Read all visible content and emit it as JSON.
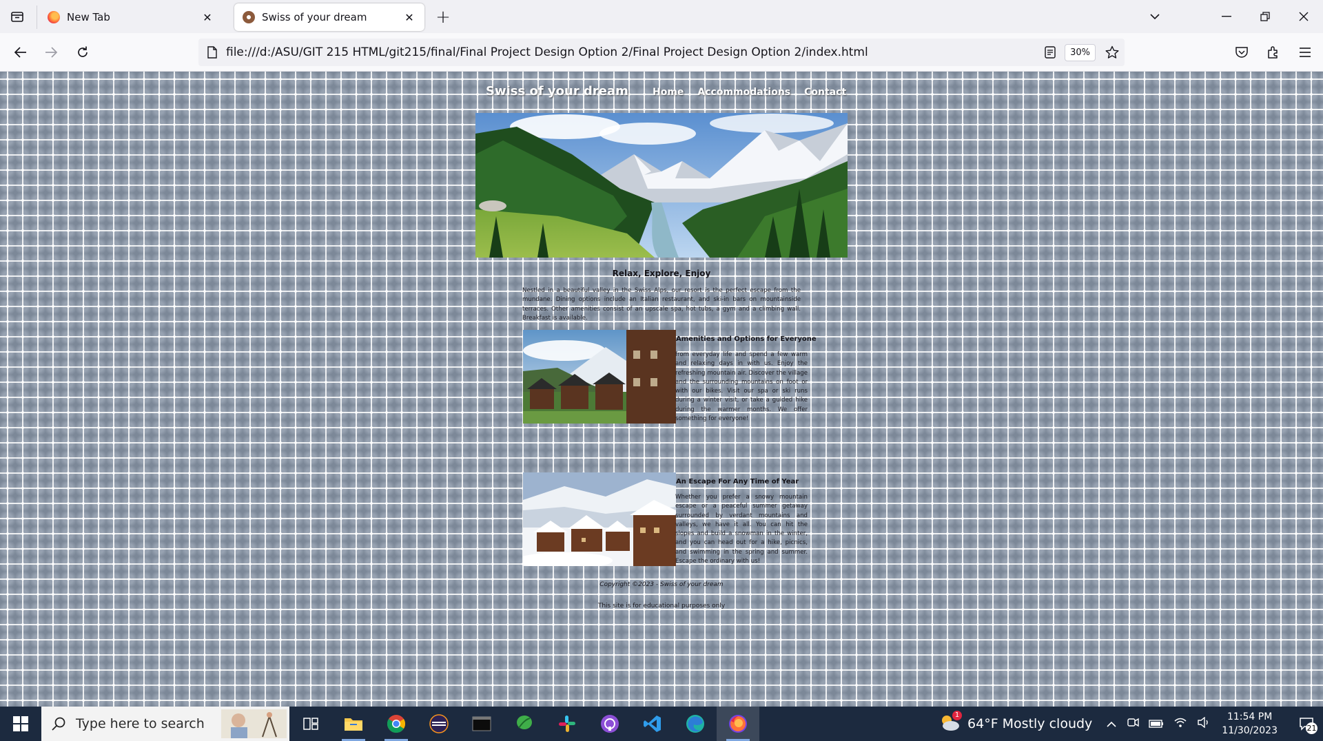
{
  "browser": {
    "tabs": [
      {
        "title": "New Tab",
        "active": false,
        "icon": "firefox-icon"
      },
      {
        "title": "Swiss of your dream",
        "active": true,
        "icon": "site-favicon"
      }
    ],
    "url": "file:///d:/ASU/GIT 215 HTML/git215/final/Final Project Design Option 2/Final Project Design Option 2/index.html",
    "zoom": "30%"
  },
  "site": {
    "title": "Swiss of your dream",
    "nav": [
      "Home",
      "Accommodations",
      "Contact"
    ],
    "tagline": "Relax, Explore, Enjoy",
    "intro": "Nestled in a beautiful valley in the Swiss Alps, our resort is the perfect escape from the mundane. Dining options include an Italian restaurant, and ski-in bars on mountainside terraces. Other amenities consist of an upscale spa, hot tubs, a gym and a climbing wall. Breakfast is available.",
    "features": [
      {
        "title": "Amenities and Options for Everyone",
        "text": "from everyday life and spend a few warm and relaxing days in with us. Enjoy the refreshing mountain air. Discover the village and the surrounding mountains on foot or with our bikes. Visit our spa or ski runs during a winter visit, or take a guided hike during the warmer months. We offer something for everyone!"
      },
      {
        "title": "An Escape For Any Time of Year",
        "text": "Whether you prefer a snowy mountain escape or a peaceful summer getaway surrounded by verdant mountains and valleys, we have it all. You can hit the slopes and build a snowman in the winter, and you can head out for a hike, picnics, and swimming in the spring and summer. Escape the ordinary with us!"
      }
    ],
    "copyright": "Copyright ©2023 - Swiss of your dream",
    "disclaimer": "This site is for educational purposes only"
  },
  "taskbar": {
    "search_placeholder": "Type here to search",
    "weather": "64°F  Mostly cloudy",
    "weather_badge": "1",
    "time": "11:54 PM",
    "date": "11/30/2023",
    "notifications": "21",
    "apps": [
      "file-explorer-icon",
      "chrome-icon",
      "eclipse-icon",
      "terminal-icon",
      "sourcetree-icon",
      "slack-icon",
      "github-desktop-icon",
      "vscode-icon",
      "edge-icon",
      "firefox-icon"
    ]
  }
}
